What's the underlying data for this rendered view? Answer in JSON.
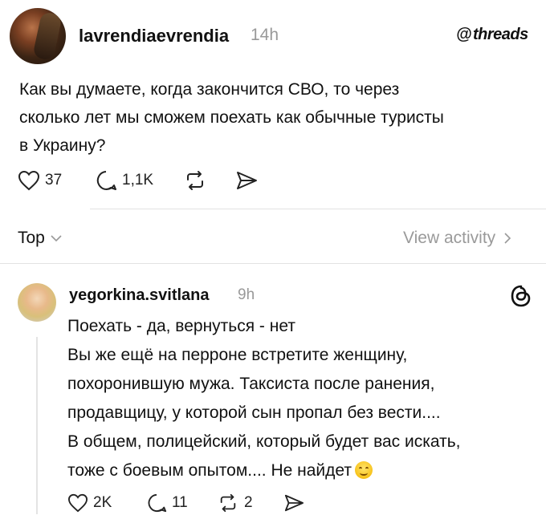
{
  "post": {
    "username": "lavrendiaevrendia",
    "time": "14h",
    "brand": "threads",
    "lines": [
      "Как вы думаете, когда закончится СВО, то через",
      "сколько лет мы сможем поехать как обычные туристы",
      "в Украину?"
    ],
    "likes": "37",
    "replies": "1,1K"
  },
  "sort": {
    "label": "Top",
    "view_activity": "View activity"
  },
  "reply": {
    "username": "yegorkina.svitlana",
    "time": "9h",
    "lines": [
      "Поехать - да, вернуться - нет",
      "Вы же ещё на перроне встретите женщину,",
      "похоронившую мужа. Таксиста после ранения,",
      "продавщицу, у которой сын пропал без вести....",
      "В общем, полицейский, который будет вас искать,",
      "тоже с боевым опытом.... Не найдет"
    ],
    "likes": "2K",
    "replies": "11",
    "reposts": "2"
  },
  "icons": {
    "like": "heart-icon",
    "reply": "comment-icon",
    "repost": "repost-icon",
    "share": "send-icon",
    "threads": "threads-logo-icon",
    "emoji": "smiling-face-emoji"
  }
}
